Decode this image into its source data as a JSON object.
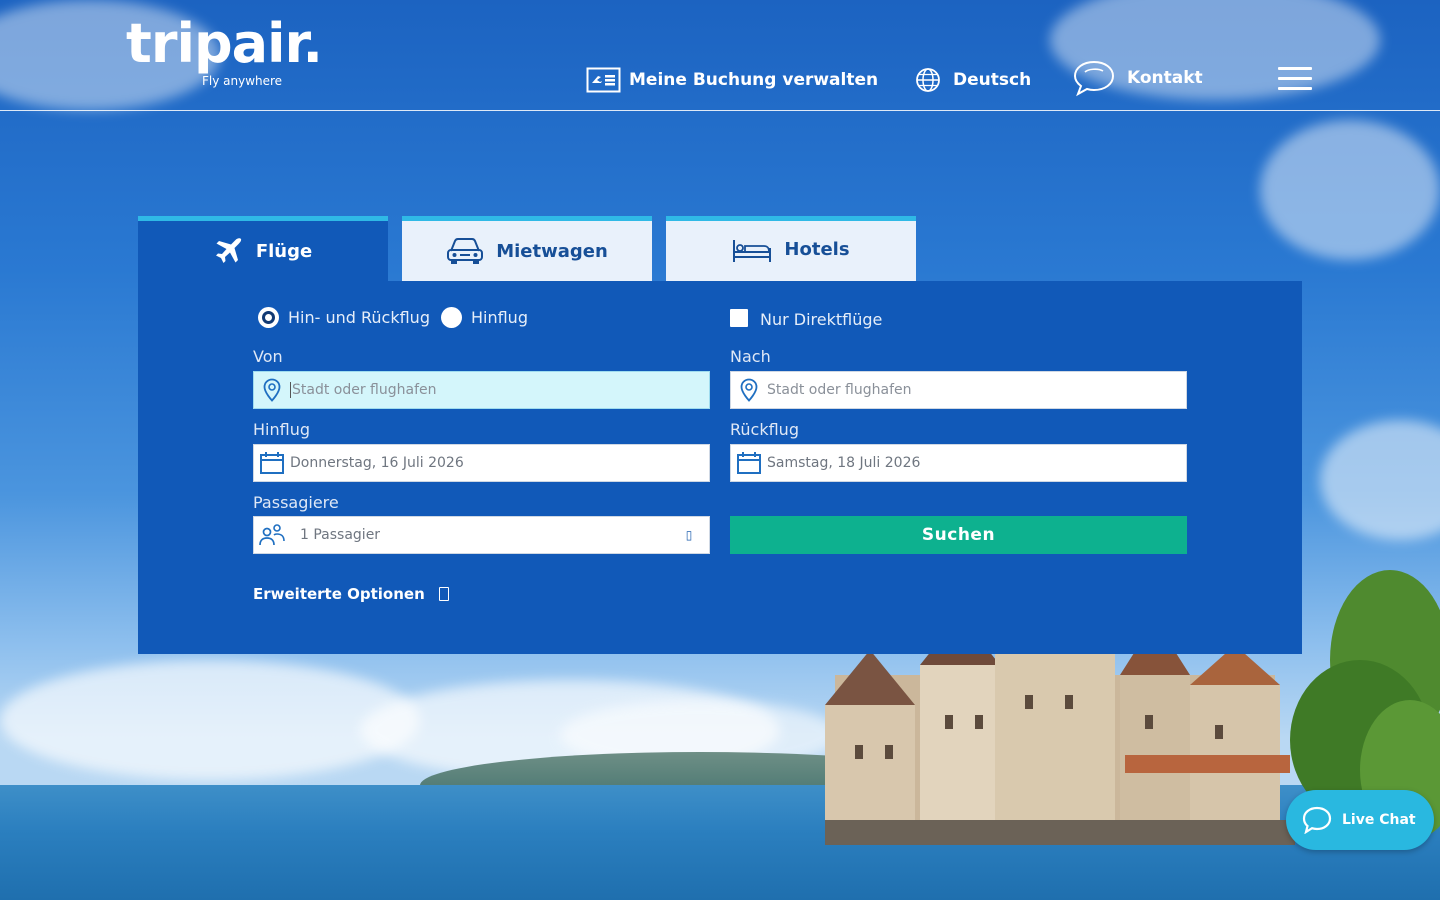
{
  "header": {
    "logo_text": "tripair.",
    "logo_tagline": "Fly anywhere",
    "nav": {
      "manage_booking": "Meine Buchung verwalten",
      "language": "Deutsch",
      "contact": "Kontakt"
    }
  },
  "tabs": [
    {
      "label": "Flüge",
      "icon": "airplane-icon",
      "active": true
    },
    {
      "label": "Mietwagen",
      "icon": "car-icon",
      "active": false
    },
    {
      "label": "Hotels",
      "icon": "bed-icon",
      "active": false
    }
  ],
  "search_form": {
    "trip_type": {
      "options": [
        "Hin- und Rückflug",
        "Hinflug"
      ],
      "selected": "Hin- und Rückflug"
    },
    "direct_only_label": "Nur Direktflüge",
    "from": {
      "label": "Von",
      "placeholder": "Stadt oder flughafen",
      "value": ""
    },
    "to": {
      "label": "Nach",
      "placeholder": "Stadt oder flughafen",
      "value": ""
    },
    "depart": {
      "label": "Hinflug",
      "value": "Donnerstag, 16 Juli 2026"
    },
    "return": {
      "label": "Rückflug",
      "value": "Samstag, 18 Juli 2026"
    },
    "passengers": {
      "label": "Passagiere",
      "value": "1 Passagier"
    },
    "search_button": "Suchen",
    "advanced_options": "Erweiterte Optionen"
  },
  "live_chat": {
    "label": "Live Chat"
  },
  "colors": {
    "panel": "#1159b8",
    "tab_accent": "#2fb9e6",
    "search_button": "#0db18f",
    "live_chat": "#29b8e0"
  }
}
